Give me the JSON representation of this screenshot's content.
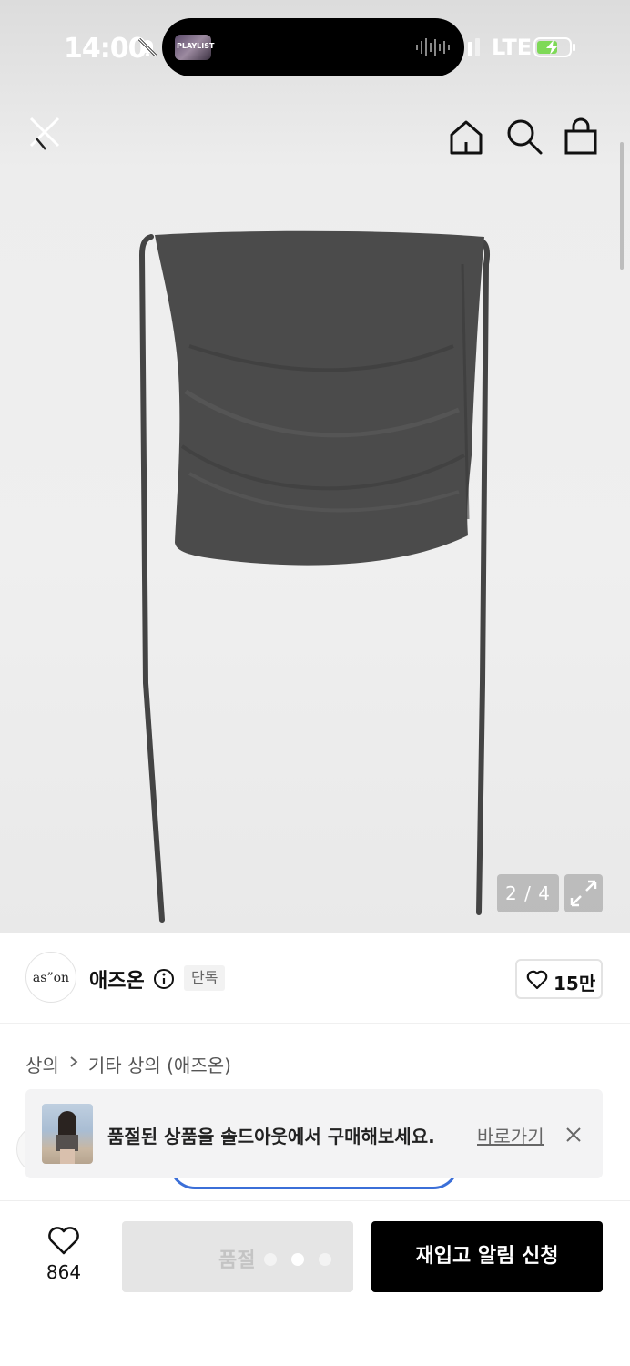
{
  "status_bar": {
    "time": "14:00",
    "network": "LTE",
    "now_playing_label": "PLAYLIST"
  },
  "header": {
    "close_icon": "close-icon",
    "home_icon": "home-icon",
    "search_icon": "search-icon",
    "bag_icon": "shopping-bag-icon"
  },
  "gallery": {
    "counter": "2 / 4",
    "expand_icon": "expand-icon"
  },
  "brand": {
    "logo_text": "as”on",
    "name": "애즈온",
    "badge": "단독",
    "likes": "15만"
  },
  "breadcrumb": {
    "category": "상의",
    "subcategory": "기타 상의 (애즈온)"
  },
  "banner": {
    "text": "품절된 상품을 솔드아웃에서 구매해보세요.",
    "link": "바로가기"
  },
  "bottom_bar": {
    "wish_count": "864",
    "soldout_label": "품절",
    "restock_label": "재입고 알림 신청"
  },
  "colors": {
    "primary_button": "#000000",
    "disabled_button": "#e5e5e5",
    "product": "#4a4a4a"
  }
}
